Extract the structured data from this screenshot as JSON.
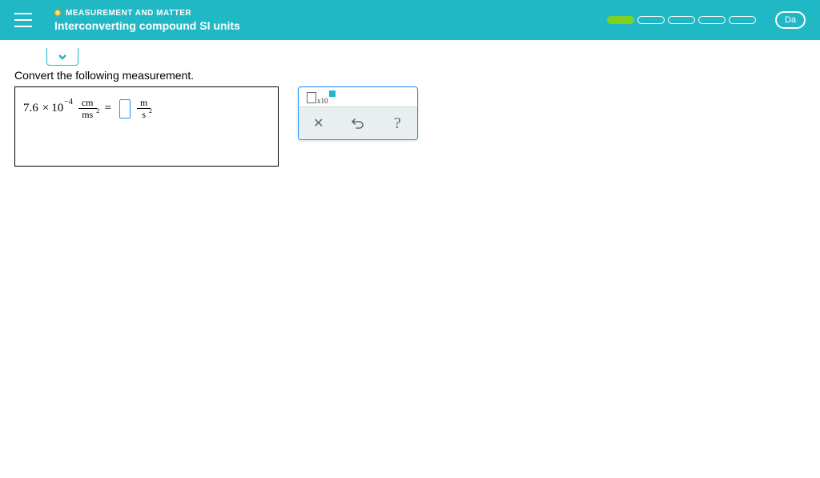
{
  "header": {
    "topic": "MEASUREMENT AND MATTER",
    "title": "Interconverting compound SI units",
    "user_label": "Da"
  },
  "prompt": "Convert the following measurement.",
  "equation": {
    "coef": "7.6",
    "base": "10",
    "exponent": "−4",
    "left_unit_num": "cm",
    "left_unit_den": "ms",
    "left_unit_den_exp": "2",
    "equals": "=",
    "right_unit_num": "m",
    "right_unit_den": "s",
    "right_unit_den_exp": "2"
  },
  "toolbox": {
    "x10_label": "x10"
  }
}
